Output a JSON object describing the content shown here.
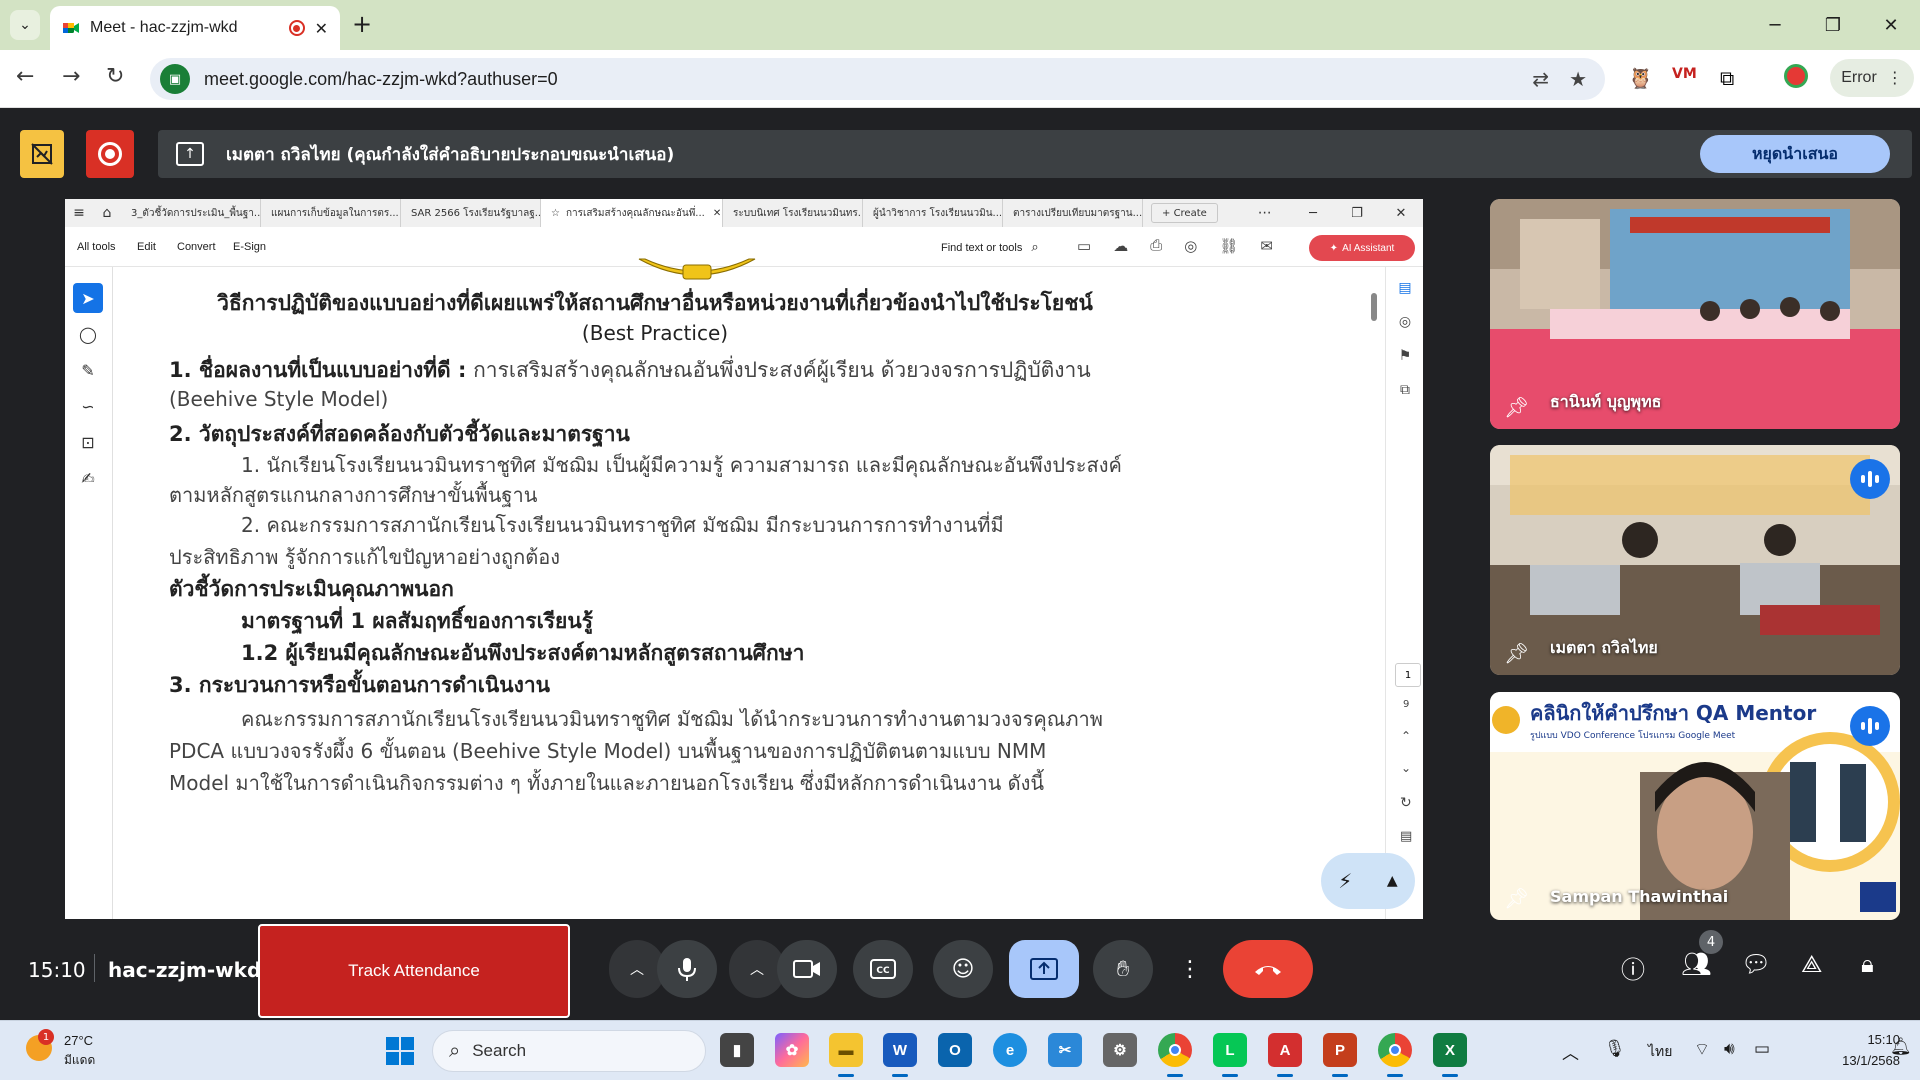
{
  "browser": {
    "tab_title": "Meet - hac-zzjm-wkd",
    "url": "meet.google.com/hac-zzjm-wkd?authuser=0",
    "profile_label": "Error"
  },
  "presenting": {
    "banner_text": "เมตตา ถวิลไทย (คุณกำลังใส่คำอธิบายประกอบขณะนำเสนอ)",
    "stop_label": "หยุดนำเสนอ"
  },
  "pdf": {
    "tabs": [
      "3_ตัวชี้วัดการประเมิน_พื้นฐา...",
      "แผนการเก็บข้อมูลในการตร...",
      "SAR 2566 โรงเรียนรัฐบาลฐ...",
      "การเสริมสร้างคุณลักษณะอันพึ่...",
      "ระบบนิเทศ โรงเรียนนวมินทร...",
      "ผู้นำวิชาการ โรงเรียนนวมิน...",
      "ตารางเปรียบเทียบมาตรฐาน..."
    ],
    "create_label": "Create",
    "menu": [
      "All tools",
      "Edit",
      "Convert",
      "E-Sign"
    ],
    "find_label": "Find text or tools",
    "ai_label": "AI Assistant",
    "page_current": "1",
    "page_total": "9",
    "doc": {
      "heading1": "วิธีการปฏิบัติของแบบอย่างที่ดีเผยแพร่ให้สถานศึกษาอื่นหรือหน่วยงานที่เกี่ยวข้องนำไปใช้ประโยชน์",
      "heading2": "(Best Practice)",
      "s1_label": "1. ชื่อผลงานที่เป็นแบบอย่างที่ดี :",
      "s1_text": "การเสริมสร้างคุณลักษณอันพึ่งประสงค์ผู้เรียน ด้วยวงจรการปฏิบัติงาน",
      "s1_text2": "(Beehive Style Model)",
      "s2_label": "2. วัตถุประสงค์ที่สอดคล้องกับตัวชี้วัดและมาตรฐาน",
      "s2_p1": "1. นักเรียนโรงเรียนนวมินทราชูทิศ มัชฌิม เป็นผู้มีความรู้ ความสามารถ และมีคุณลักษณะอันพึงประสงค์",
      "s2_p1b": "ตามหลักสูตรแกนกลางการศึกษาขั้นพื้นฐาน",
      "s2_p2": "2. คณะกรรมการสภานักเรียนโรงเรียนนวมินทราชูทิศ มัชฌิม มีกระบวนการการทำงานที่มี",
      "s2_p2b": "ประสิทธิภาพ รู้จักการแก้ไขปัญหาอย่างถูกต้อง",
      "kpi_label": "ตัวชี้วัดการประเมินคุณภาพนอก",
      "standard": "มาตรฐานที่ 1 ผลสัมฤทธิ์ของการเรียนรู้",
      "standard_sub": "1.2 ผู้เรียนมีคุณลักษณะอันพึงประสงค์ตามหลักสูตรสถานศึกษา",
      "s3_label": "3. กระบวนการหรือขั้นตอนการดำเนินงาน",
      "s3_p1": "คณะกรรมการสภานักเรียนโรงเรียนนวมินทราชูทิศ มัชฌิม ได้นำกระบวนการทำงานตามวงจรคุณภาพ",
      "s3_p2": "PDCA แบบวงจรรังผึ้ง 6 ขั้นตอน (Beehive Style Model) บนพื้นฐานของการปฏิบัติตนตามแบบ NMM",
      "s3_p3": "Model มาใช้ในการดำเนินกิจกรรมต่าง ๆ ทั้งภายในและภายนอกโรงเรียน ซึ่งมีหลักการดำเนินงาน ดังนี้"
    }
  },
  "participants": [
    {
      "name": "ธานินท์ บุญพุทธ",
      "speaking": false
    },
    {
      "name": "เมตตา ถวิลไทย",
      "speaking": true
    },
    {
      "name": "Sampan Thawinthai",
      "speaking": true
    }
  ],
  "meeting": {
    "time": "15:10",
    "code": "hac-zzjm-wkd",
    "track_attendance_label": "Track Attendance",
    "participant_count": "4"
  },
  "taskbar": {
    "weather_temp": "27°C",
    "weather_cond": "มีแดด",
    "weather_alert": "1",
    "search_label": "Search",
    "language": "ไทย",
    "clock_time": "15:10",
    "clock_date": "13/1/2568"
  }
}
